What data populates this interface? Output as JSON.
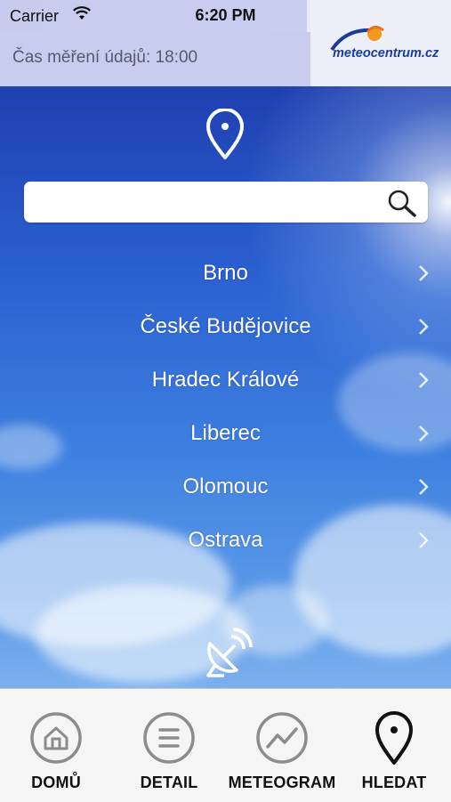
{
  "status_bar": {
    "carrier": "Carrier",
    "time": "6:20 PM"
  },
  "header": {
    "measure_time": "Čas měření údajů: 18:00",
    "logo_text": "meteocentrum.cz"
  },
  "search": {
    "placeholder": "",
    "value": ""
  },
  "cities": [
    {
      "name": "Brno"
    },
    {
      "name": "České Budějovice"
    },
    {
      "name": "Hradec Králové"
    },
    {
      "name": "Liberec"
    },
    {
      "name": "Olomouc"
    },
    {
      "name": "Ostrava"
    }
  ],
  "tabs": [
    {
      "label": "DOMŮ",
      "icon": "home-icon"
    },
    {
      "label": "DETAIL",
      "icon": "list-icon"
    },
    {
      "label": "METEOGRAM",
      "icon": "chart-icon"
    },
    {
      "label": "HLEDAT",
      "icon": "location-pin-icon",
      "active": true
    }
  ],
  "colors": {
    "accent": "#1b3b9a",
    "header_bg": "#c8ccef",
    "sky": "#2a5fd0"
  }
}
